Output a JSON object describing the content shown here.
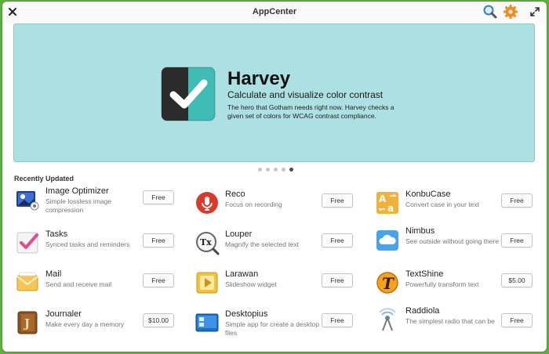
{
  "window": {
    "title": "AppCenter"
  },
  "banner": {
    "name": "Harvey",
    "tagline": "Calculate and visualize color contrast",
    "description": "The hero that Gotham needs right now. Harvey checks a given set of colors for WCAG contrast compliance.",
    "colors": {
      "background": "#ace0e2",
      "icon_dark": "#2b2b2b",
      "icon_accent": "#3fbcb5"
    },
    "page_count": 5,
    "active_page": 5
  },
  "section": {
    "title": "Recently Updated"
  },
  "apps": [
    {
      "name": "Image Optimizer",
      "description": "Simple lossless image compression",
      "price": "Free",
      "icon": "image-optimizer-icon"
    },
    {
      "name": "Reco",
      "description": "Focus on recording",
      "price": "Free",
      "icon": "microphone-icon"
    },
    {
      "name": "KonbuCase",
      "description": "Convert case in your text",
      "price": "Free",
      "icon": "text-case-icon"
    },
    {
      "name": "Tasks",
      "description": "Synced tasks and reminders",
      "price": "Free",
      "icon": "checkmark-icon"
    },
    {
      "name": "Louper",
      "description": "Magnify the selected text",
      "price": "Free",
      "icon": "magnifier-icon"
    },
    {
      "name": "Nimbus",
      "description": "See outside without going there",
      "price": "Free",
      "icon": "cloud-icon"
    },
    {
      "name": "Mail",
      "description": "Send and receive mail",
      "price": "Free",
      "icon": "envelope-icon"
    },
    {
      "name": "Larawan",
      "description": "Slideshow widget",
      "price": "Free",
      "icon": "play-icon"
    },
    {
      "name": "TextShine",
      "description": "Powerfully transform text",
      "price": "$5.00",
      "icon": "text-shine-icon"
    },
    {
      "name": "Journaler",
      "description": "Make every day a memory",
      "price": "$10.00",
      "icon": "journal-icon"
    },
    {
      "name": "Desktopius",
      "description": "Simple app for create a desktop files",
      "price": "Free",
      "icon": "desktop-file-icon"
    },
    {
      "name": "Raddiola",
      "description": "The simplest radio that can be",
      "price": "Free",
      "icon": "radio-icon"
    }
  ]
}
